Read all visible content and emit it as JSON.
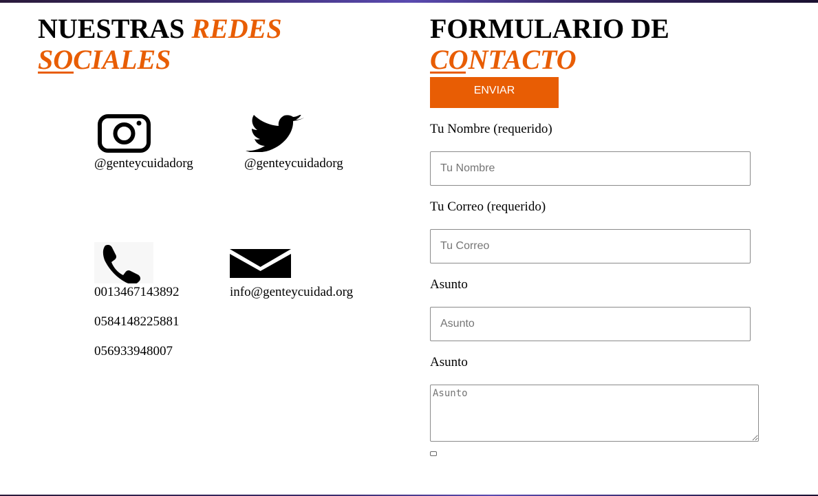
{
  "social_section": {
    "heading_plain": "NUESTRAS",
    "heading_accent_1": "REDES",
    "heading_accent_2": "SOCIALES",
    "instagram_handle": "@genteycuidadorg",
    "twitter_handle": "@genteycuidadorg",
    "phones": [
      "0013467143892",
      "0584148225881",
      "056933948007"
    ],
    "email": "info@genteycuidad.org"
  },
  "form_section": {
    "heading_plain": "FORMULARIO DE",
    "heading_accent": "CONTACTO",
    "submit_label": "ENVIAR",
    "fields": [
      {
        "label": "Tu Nombre (requerido)",
        "placeholder": "Tu Nombre"
      },
      {
        "label": "Tu Correo (requerido)",
        "placeholder": "Tu Correo"
      },
      {
        "label": "Asunto",
        "placeholder": "Asunto"
      },
      {
        "label": "Asunto",
        "placeholder": "Asunto"
      }
    ]
  },
  "icons": {
    "instagram": "instagram-icon",
    "twitter": "twitter-icon",
    "phone": "phone-icon",
    "email": "envelope-icon"
  },
  "colors": {
    "accent": "#e85d04",
    "text": "#000000",
    "background": "#ffffff"
  }
}
